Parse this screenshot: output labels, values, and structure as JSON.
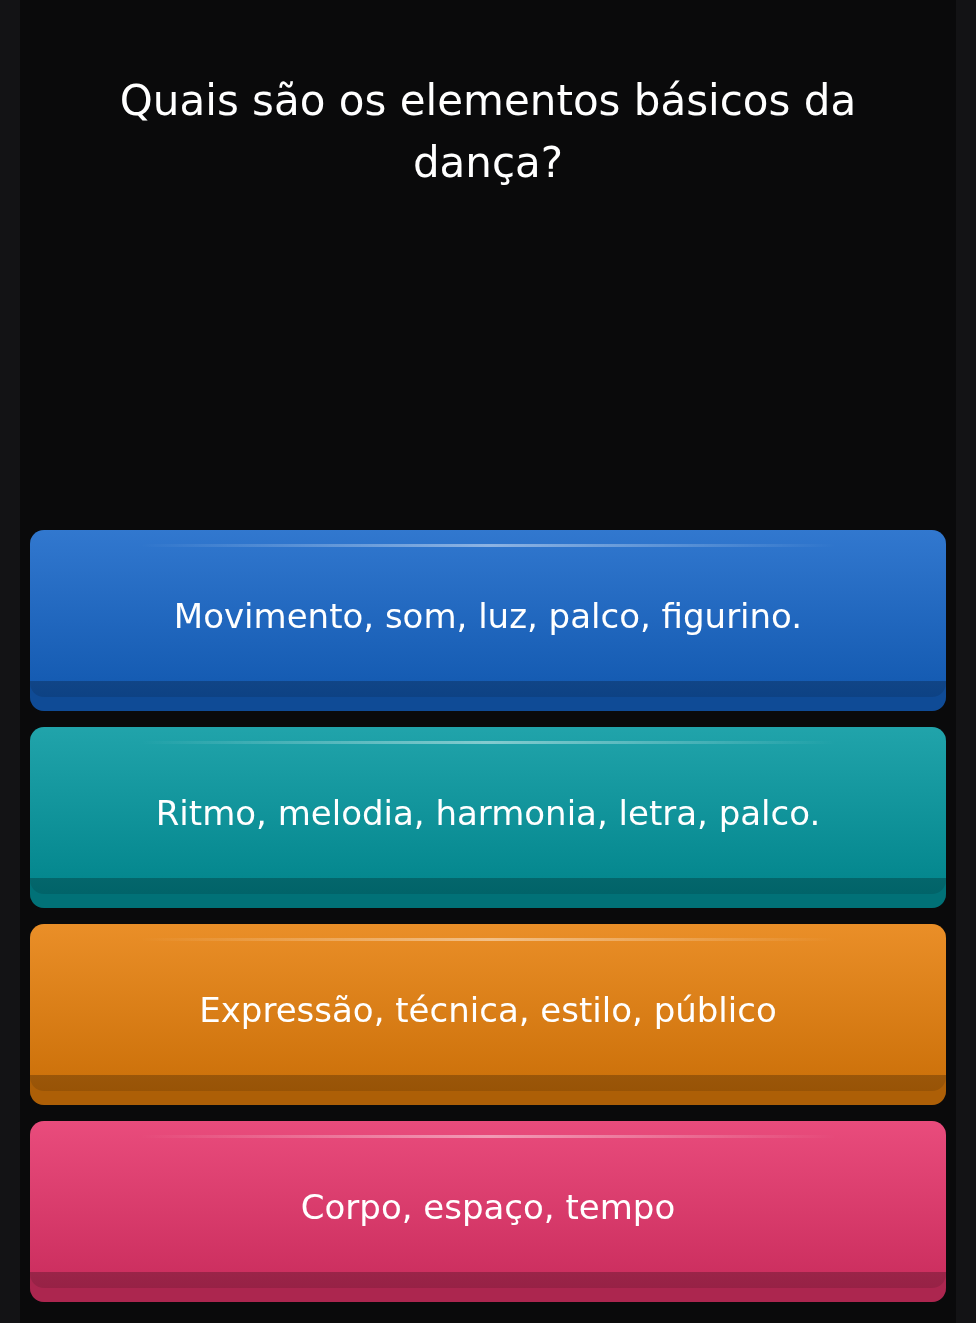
{
  "question": "Quais são os elementos básicos da dança?",
  "answers": [
    {
      "label": "Movimento, som, luz, palco, figurino.",
      "color": "#1565c8"
    },
    {
      "label": "Ritmo, melodia, harmonia, letra, palco.",
      "color": "#02979f"
    },
    {
      "label": "Expressão, técnica, estilo, público",
      "color": "#e77f0a"
    },
    {
      "label": "Corpo, espaço, tempo",
      "color": "#e6336a"
    }
  ]
}
